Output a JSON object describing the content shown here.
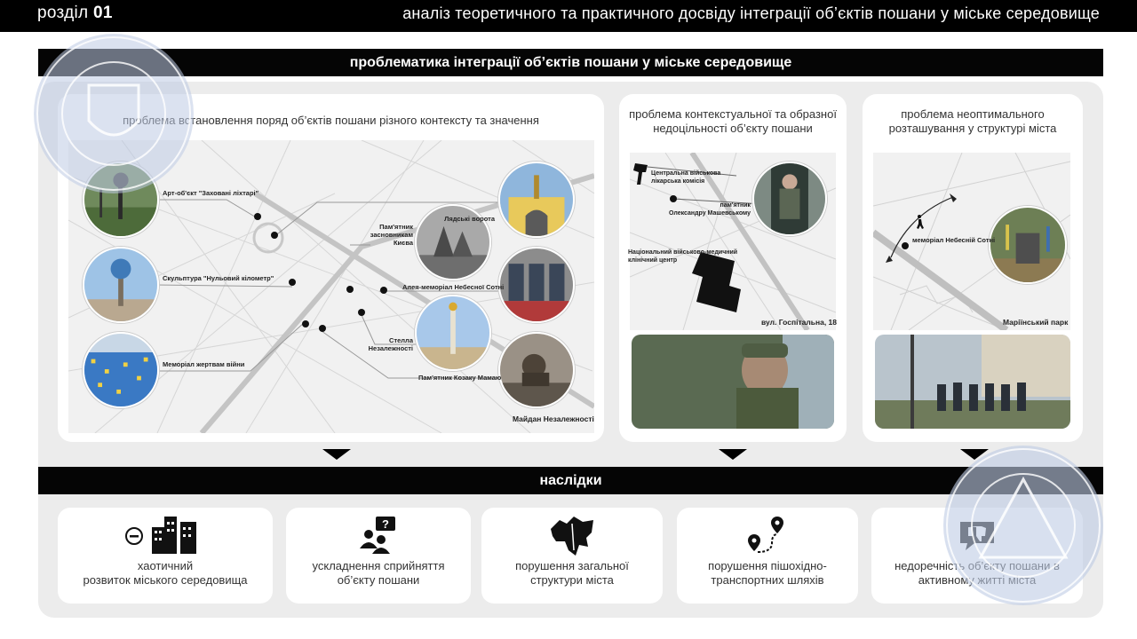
{
  "header": {
    "section_word": "розділ",
    "section_number": "01",
    "title": "аналіз теоретичного та практичного досвіду інтеграції об’єктів пошани у міське середовище"
  },
  "problems_band": "проблематика інтеграції об’єктів пошани у міське середовище",
  "panel1": {
    "title": "проблема встановлення поряд об’єктів пошани різного контексту та значення",
    "labels": {
      "art_object": "Арт-об'єкт \"Заховані ліхтарі\"",
      "sculpture": "Скульптура \"Нульовий кілометр\"",
      "memorial_war": "Меморіал жертвам війни",
      "lyadski": "Лядські ворота",
      "founders_1": "Пам'ятник",
      "founders_2": "засновникам",
      "founders_3": "Києва",
      "alley": "Алея-меморіал Небесної Сотні",
      "stela_1": "Стелла",
      "stela_2": "Незалежності",
      "mamai": "Пам'ятник Козаку Мамаю",
      "maidan": "Майдан Незалежності"
    }
  },
  "panel2": {
    "title": "проблема контекстуальної та образної недоцільності об’єкту пошани",
    "labels": {
      "commission_1": "Центральна військова",
      "commission_2": "лікарська комісія",
      "monument_1": "пам'ятник",
      "monument_2": "Олександру Машевському",
      "center_1": "Національний військово-медичний",
      "center_2": "клінічний центр",
      "street": "вул. Госпітальна, 18"
    }
  },
  "panel3": {
    "title": "проблема неоптимального розташування у структурі міста",
    "labels": {
      "memorial": "меморіал Небесній Сотні",
      "park": "Маріїнський парк"
    }
  },
  "effects_band": "наслідки",
  "effects": [
    {
      "icon": "buildings-minus-icon",
      "line1": "хаотичний",
      "line2": "розвиток міського середовища"
    },
    {
      "icon": "people-question-icon",
      "line1": "ускладнення сприйняття",
      "line2": "об’єкту пошани"
    },
    {
      "icon": "city-map-icon",
      "line1": "порушення загальної",
      "line2": "структури міста"
    },
    {
      "icon": "route-pins-icon",
      "line1": "порушення пішохідно-",
      "line2": "транспортних шляхів"
    },
    {
      "icon": "thumbs-down-chat-icon",
      "line1": "недоречність об’єкту пошани в",
      "line2": "активному житті міста"
    }
  ],
  "colors": {
    "band": "#050505",
    "outer_background": "#ececec",
    "seal": "#c9d3e6"
  }
}
